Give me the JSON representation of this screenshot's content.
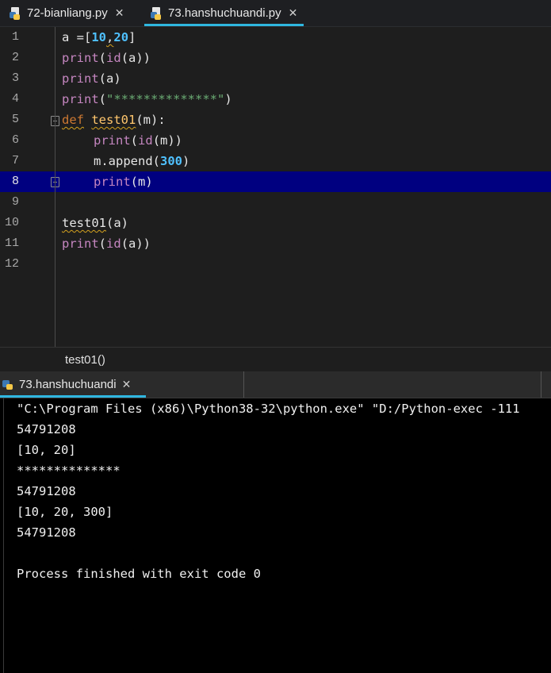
{
  "tabs": [
    {
      "label": "72-bianliang.py",
      "active": false
    },
    {
      "label": "73.hanshuchuandi.py",
      "active": true
    }
  ],
  "editor": {
    "line_numbers": [
      "1",
      "2",
      "3",
      "4",
      "5",
      "6",
      "7",
      "8",
      "9",
      "10",
      "11",
      "12"
    ],
    "current_line": 8
  },
  "code": {
    "l1_a": "a =",
    "l1_b": "[",
    "l1_n1": "10",
    "l1_c": ",",
    "l1_n2": "20",
    "l1_d": "]",
    "l2_print": "print",
    "l2_open": "(",
    "l2_id": "id",
    "l2_rest": "(a))",
    "l3_print": "print",
    "l3_rest": "(a)",
    "l4_print": "print",
    "l4_open": "(",
    "l4_str": "\"**************\"",
    "l4_close": ")",
    "l5_def": "def",
    "l5_name": "test01",
    "l5_rest": "(m):",
    "l6_print": "print",
    "l6_open": "(",
    "l6_id": "id",
    "l6_rest": "(m))",
    "l7_a": "m.append(",
    "l7_num": "300",
    "l7_b": ")",
    "l8_print": "print",
    "l8_rest": "(m)",
    "l10_call": "test01",
    "l10_rest": "(a)",
    "l11_print": "print",
    "l11_open": "(",
    "l11_id": "id",
    "l11_rest": "(a))"
  },
  "breadcrumb": "test01()",
  "run": {
    "tab_label": "73.hanshuchuandi",
    "output": [
      "\"C:\\Program Files (x86)\\Python38-32\\python.exe\" \"D:/Python-exec -111",
      "54791208",
      "[10, 20]",
      "**************",
      "54791208",
      "[10, 20, 300]",
      "54791208",
      "",
      "Process finished with exit code 0"
    ]
  },
  "colors": {
    "accent": "#2fb7e0",
    "current_line": "#000080",
    "keyword": "#cc7832",
    "number": "#4fc1ff",
    "string": "#6aab73"
  }
}
